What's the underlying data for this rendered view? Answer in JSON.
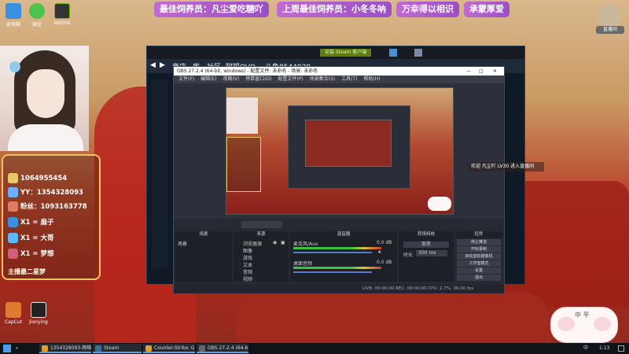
{
  "banners": [
    {
      "text": "最佳饲养员：凡尘爱吃糖吖"
    },
    {
      "text": "上周最佳饲养员：小冬冬呐"
    },
    {
      "text": "万幸得以相识"
    },
    {
      "text": "承蒙厚爱"
    }
  ],
  "desktop_icons": [
    {
      "label": "此电脑",
      "color": "#3b8fe0"
    },
    {
      "label": "微信",
      "color": "#4cc34c"
    },
    {
      "label": "NVIDIA",
      "color": "#333"
    },
    {
      "label": "CapCut",
      "color": "#e07a30"
    },
    {
      "label": "Jianying",
      "color": "#222"
    }
  ],
  "supporters": [
    {
      "text": "1064955454",
      "color": "#e8c66a"
    },
    {
      "text": "YY：1354328093",
      "color": "#6bb0ff"
    },
    {
      "text": "粉丝：1093163778",
      "color": "#e07a60"
    },
    {
      "text": "X1 = 扇子",
      "color": "#3b8fe0"
    },
    {
      "text": "X1 = 大哥",
      "color": "#5db8ff"
    },
    {
      "text": "X1 = 梦想",
      "color": "#d0607a"
    }
  ],
  "supporters_footer": "主播最二星梦",
  "browser": {
    "nav": [
      "商店",
      "库",
      "社区",
      "阿银OVO",
      "斗鱼8544029"
    ],
    "top_button": "安装 Steam 客户端"
  },
  "obs": {
    "title": "OBS 27.2.4 (64-bit, windows) - 配置文件: 未命名 - 场景: 未命名",
    "menu": [
      "文件(F)",
      "编辑(E)",
      "视图(V)",
      "停靠窗口(D)",
      "配置文件(P)",
      "场景集合(S)",
      "工具(T)",
      "帮助(H)"
    ],
    "dock_headers": [
      "场景",
      "来源",
      "混音器",
      "转场特效",
      "控件"
    ],
    "scene": "场景",
    "sources": [
      "浏览器源",
      "图像",
      "游戏",
      "文本",
      "音频",
      "视频"
    ],
    "mixer": [
      {
        "name": "麦克风/Aux",
        "db": "0.0 dB"
      },
      {
        "name": "桌面音频",
        "db": "0.0 dB"
      }
    ],
    "transition": {
      "type": "渐变",
      "duration_label": "时长",
      "duration": "300 ms"
    },
    "controls": [
      "停止推流",
      "开始录制",
      "启动虚拟摄像机",
      "工作室模式",
      "设置",
      "退出"
    ],
    "status": "LIVE: 00:00:00    REC: 00:00:00    CPU: 2.7%, 30.00 fps"
  },
  "welcome": "欢迎 凡尘吖 LV30 进入直播间",
  "user_tag": "直播间",
  "sticker_text": "中 平",
  "taskbar": [
    {
      "label": "1354328093-网络斗...",
      "color": "#e0a030"
    },
    {
      "label": "Steam",
      "color": "#3b6ea0"
    },
    {
      "label": "Counter-Strike: Glo...",
      "color": "#e0a030"
    },
    {
      "label": "OBS 27.2.4 (64-bit...",
      "color": "#555"
    }
  ],
  "clock": "1:13",
  "input_method": "中"
}
